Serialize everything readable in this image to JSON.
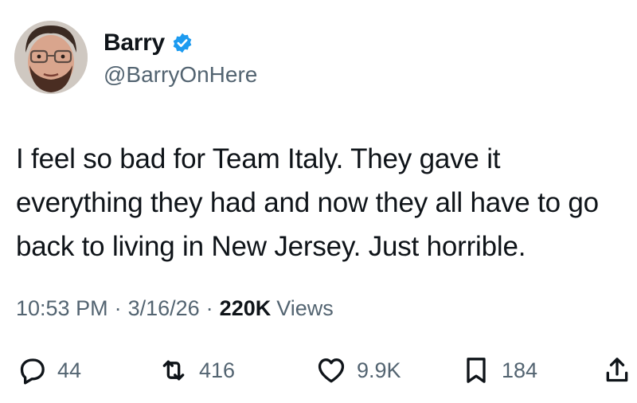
{
  "author": {
    "display_name": "Barry",
    "handle": "@BarryOnHere",
    "verified": true,
    "verified_icon": "verified-badge-icon",
    "avatar_icon": "profile-avatar"
  },
  "tweet": {
    "lines": [
      "I feel so bad for Team Italy. They gave it",
      "everything they had and now they all have to go",
      "back to living in New Jersey. Just horrible."
    ]
  },
  "meta": {
    "time": "10:53 PM",
    "separator": "·",
    "date": "3/16/26",
    "views_count": "220K",
    "views_label": "Views"
  },
  "actions": {
    "reply": {
      "icon": "reply-icon",
      "count": "44"
    },
    "retweet": {
      "icon": "retweet-icon",
      "count": "416"
    },
    "like": {
      "icon": "heart-icon",
      "count": "9.9K"
    },
    "bookmark": {
      "icon": "bookmark-icon",
      "count": "184"
    },
    "share": {
      "icon": "share-icon"
    }
  },
  "colors": {
    "text_primary": "#0f1419",
    "text_secondary": "#536471",
    "verified_blue": "#1d9bf0",
    "background": "#ffffff"
  }
}
